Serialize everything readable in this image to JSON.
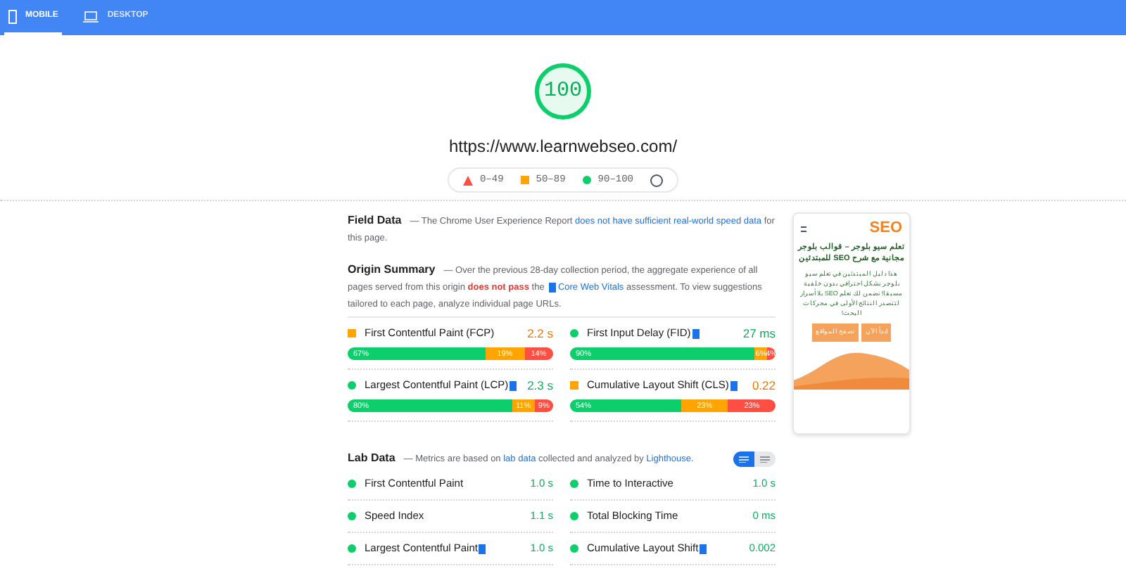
{
  "tabs": [
    {
      "label": "MOBILE",
      "selected": true
    },
    {
      "label": "DESKTOP",
      "selected": false
    }
  ],
  "score": "100",
  "url": "https://www.learnwebseo.com/",
  "legend": [
    {
      "kind": "fail",
      "label": "0–49"
    },
    {
      "kind": "average",
      "label": "50–89"
    },
    {
      "kind": "pass",
      "label": "90–100"
    }
  ],
  "field_data": {
    "title": "Field Data",
    "text": "— The Chrome User Experience Report ",
    "link": "does not have sufficient real-world speed data",
    "tail": " for this page."
  },
  "origin_summary": {
    "title": "Origin Summary",
    "text": "— Over the previous 28-day collection period, the aggregate experience of all pages served from this origin ",
    "fail_text": "does not pass",
    "mid": " the ",
    "link": "Core Web Vitals",
    "tail": " assessment. To view suggestions tailored to each page, analyze individual page URLs."
  },
  "field_metrics": [
    {
      "name": "First Contentful Paint (FCP)",
      "kind": "average",
      "vital": false,
      "value": "2.2 s",
      "bars": [
        {
          "kind": "fast",
          "label": "67%"
        },
        {
          "kind": "average",
          "label": "19%"
        },
        {
          "kind": "slow",
          "label": "14%"
        }
      ]
    },
    {
      "name": "First Input Delay (FID)",
      "kind": "fast",
      "vital": true,
      "value": "27 ms",
      "bars": [
        {
          "kind": "fast",
          "label": "90%"
        },
        {
          "kind": "average",
          "label": "6%"
        },
        {
          "kind": "slow",
          "label": "4%"
        }
      ]
    },
    {
      "name": "Largest Contentful Paint (LCP)",
      "kind": "fast",
      "vital": true,
      "value": "2.3 s",
      "bars": [
        {
          "kind": "fast",
          "label": "80%"
        },
        {
          "kind": "average",
          "label": "11%"
        },
        {
          "kind": "slow",
          "label": "9%"
        }
      ]
    },
    {
      "name": "Cumulative Layout Shift (CLS)",
      "kind": "average",
      "vital": true,
      "value": "0.22",
      "bars": [
        {
          "kind": "fast",
          "label": "54%"
        },
        {
          "kind": "average",
          "label": "23%"
        },
        {
          "kind": "slow",
          "label": "23%"
        }
      ]
    }
  ],
  "preview": {
    "logo": "SEO",
    "heading": "تعلم سيو بلوجر – قوالب بلوجر مجانية مع شرح SEO للمبتدئين",
    "text": "هذا دليل المبتدئين في تعلم سيو بلوجر بشكل احترافي بدون خلفية مسبقا! نضمن لك تعلم SEO بلا أسرار لتتصدر النتائج الأولى في محركات البحث!",
    "buttons": [
      "ابدأ الآن",
      "تصفح المواقع"
    ]
  },
  "lab_data": {
    "title": "Lab Data",
    "text": "— Metrics are based on ",
    "link": "lab data",
    "mid": " collected and analyzed by ",
    "link2": "Lighthouse",
    "tail": "."
  },
  "view_toggle": [
    {
      "selected": true
    },
    {
      "selected": false
    }
  ],
  "lab_metrics": [
    {
      "name": "First Contentful Paint",
      "kind": "fast",
      "vital": false,
      "value": "1.0 s"
    },
    {
      "name": "Time to Interactive",
      "kind": "fast",
      "vital": false,
      "value": "1.0 s"
    },
    {
      "name": "Speed Index",
      "kind": "fast",
      "vital": false,
      "value": "1.1 s"
    },
    {
      "name": "Total Blocking Time",
      "kind": "fast",
      "vital": false,
      "value": "0 ms"
    },
    {
      "name": "Largest Contentful Paint",
      "kind": "fast",
      "vital": true,
      "value": "1.0 s"
    },
    {
      "name": "Cumulative Layout Shift",
      "kind": "fast",
      "vital": true,
      "value": "0.002"
    }
  ]
}
